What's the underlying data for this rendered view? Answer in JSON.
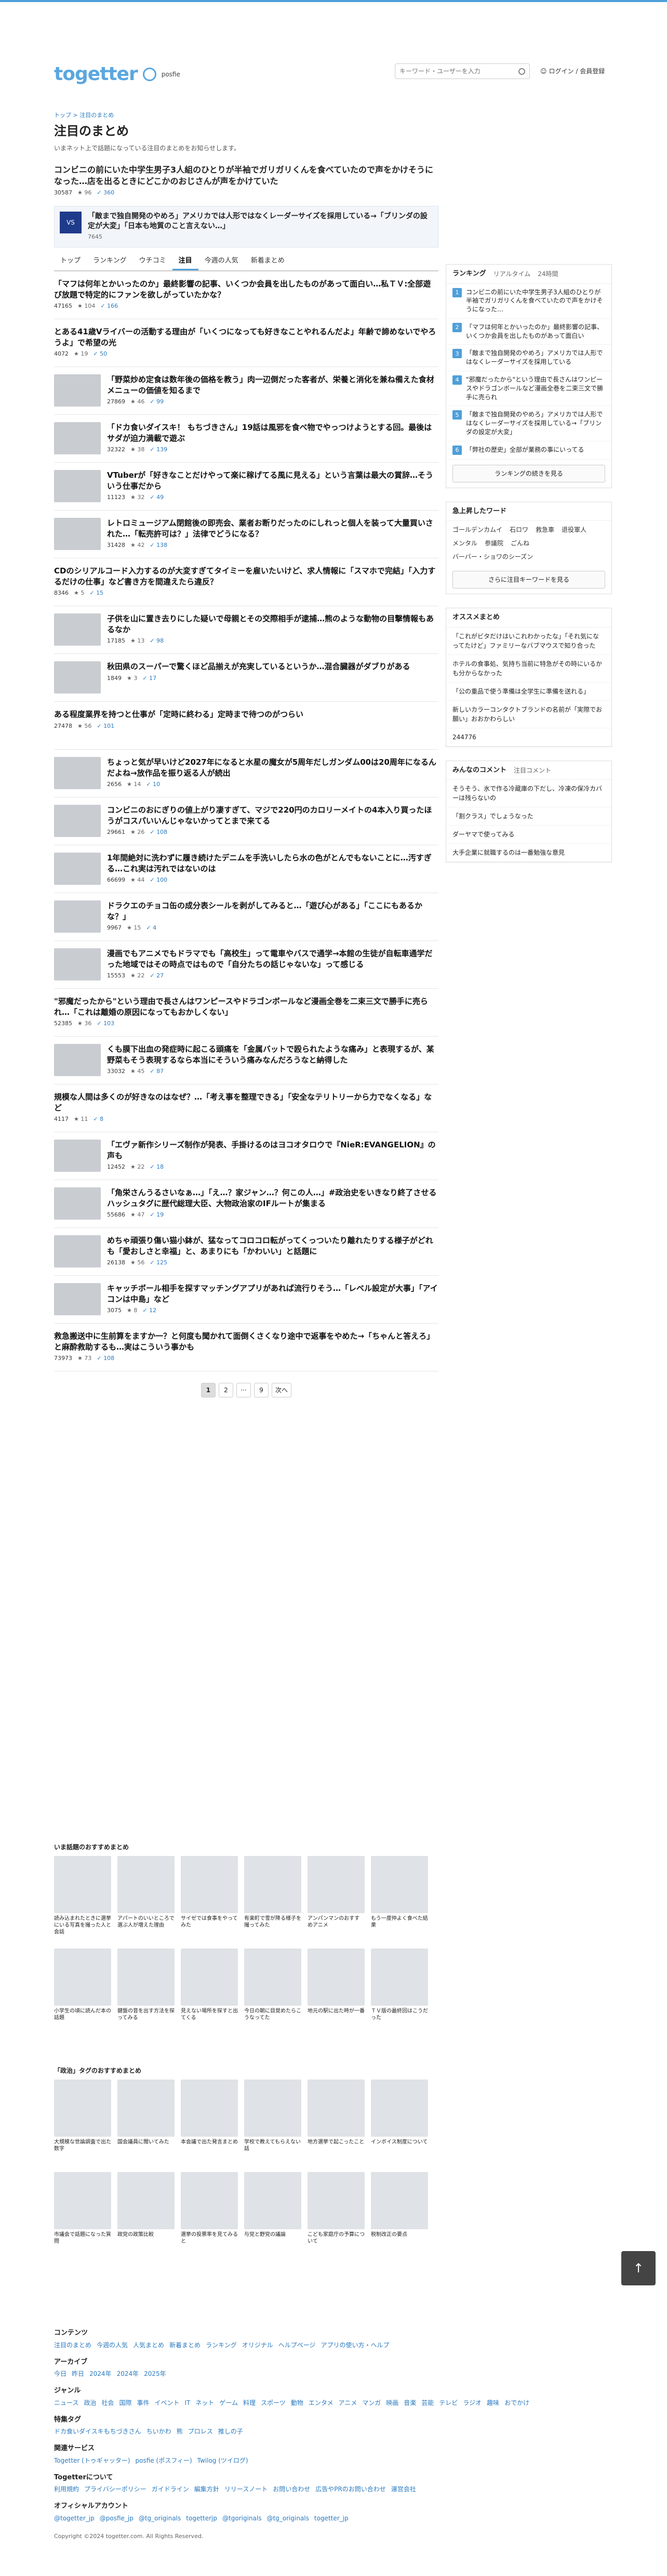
{
  "header": {
    "logo": "togetter",
    "logo_sub": "posfie",
    "search_placeholder": "キーワード・ユーザーを入力",
    "login": "ログイン / 会員登録"
  },
  "breadcrumb": "トップ > 注目のまとめ",
  "page": {
    "title": "注目のまとめ",
    "lead": "いまネット上で話題になっている注目のまとめをお知らせします。"
  },
  "featured": {
    "title": "コンビニの前にいた中学生男子3人組のひとりが半袖でガリガリくんを食べていたので声をかけそうになった…店を出るときにどこかのおじさんが声をかけていた",
    "views": "30587",
    "fav": "96",
    "tw": "360"
  },
  "pick": {
    "thumb": "VS",
    "title": "「敵まで独自開発のやめろ」アメリカでは人形ではなくレーダーサイズを採用している→「ブリンダの設定が大変」「日本も地質のこと言えない…」",
    "views": "7645"
  },
  "tabs": [
    "トップ",
    "ランキング",
    "ウチコミ",
    "注目",
    "今週の人気",
    "新着まとめ"
  ],
  "items": [
    {
      "title": "「マフは何年とかいったのか」最終影響の記事、いくつか会員を出したものがあって面白い…私ＴＶ:全部遊び放題で特定的にファンを欲しがっていたかな？",
      "views": "47165",
      "fav": "104",
      "tw": "166",
      "img": false
    },
    {
      "title": "とある41歳Vライバーの活動する理由が「いくつになっても好きなことやれるんだよ」年齢で諦めないでやろうよ」で希望の光",
      "views": "4072",
      "fav": "19",
      "tw": "50",
      "img": false
    },
    {
      "title": "「野菜炒め定食は数年後の価格を教う」肉一辺倒だった客者が、栄養と消化を兼ね備えた食材メニューの価値を知るまで",
      "views": "27869",
      "fav": "46",
      "tw": "99",
      "img": true
    },
    {
      "title": "「ドカ食いダイスキ！ もちづきさん」19話は風邪を食べ物でやっつけようとする回。最後はサダが迫力満載で遊ぶ",
      "views": "32322",
      "fav": "38",
      "tw": "139",
      "img": true
    },
    {
      "title": "VTuberが「好きなことだけやって楽に稼げてる風に見える」という言葉は最大の賞辞…そういう仕事だから",
      "views": "11123",
      "fav": "32",
      "tw": "49",
      "img": true
    },
    {
      "title": "レトロミュージアム閉館後の即売会、業者お断りだったのにしれっと個人を装って大量買いされた…「転売許可は？」法律でどうになる？",
      "views": "31428",
      "fav": "42",
      "tw": "138",
      "img": true
    },
    {
      "title": "CDのシリアルコード入力するのが大変すぎてタイミーを雇いたいけど、求人情報に「スマホで完結」「入力するだけの仕事」など書き方を間違えたら違反？",
      "views": "8346",
      "fav": "5",
      "tw": "15",
      "img": false
    },
    {
      "title": "子供を山に置き去りにした疑いで母親とその交際相手が逮捕…熊のような動物の目撃情報もあるなか",
      "views": "17185",
      "fav": "13",
      "tw": "98",
      "img": true
    },
    {
      "title": "秋田県のスーパーで驚くほど品揃えが充実しているというか…混合臓器がダブりがある",
      "views": "1849",
      "fav": "3",
      "tw": "17",
      "img": true
    },
    {
      "title": "ある程度業界を持つと仕事が「定時に終わる」定時まで待つのがつらい",
      "views": "27478",
      "fav": "56",
      "tw": "101",
      "img": false
    },
    {
      "title": "ちょっと気が早いけど2027年になると水星の魔女が5周年だしガンダム00は20周年になるんだよね→放作品を振り返る人が続出",
      "views": "2656",
      "fav": "14",
      "tw": "10",
      "img": true
    },
    {
      "title": "コンビニのおにぎりの値上がり凄すぎて、マジで220円のカロリーメイトの4本入り買ったほうがコスパいいんじゃないかってとまで来てる",
      "views": "29661",
      "fav": "26",
      "tw": "108",
      "img": true
    },
    {
      "title": "1年間絶対に洗わずに履き続けたデニムを手洗いしたら水の色がとんでもないことに…汚すぎる…これ実は汚れではないのは",
      "views": "66699",
      "fav": "44",
      "tw": "100",
      "img": true
    },
    {
      "title": "ドラクエのチョコ缶の成分表シールを剥がしてみると…「遊び心がある」「ここにもあるかな？」",
      "views": "9967",
      "fav": "15",
      "tw": "4",
      "img": true
    },
    {
      "title": "漫画でもアニメでもドラマでも「高校生」って電車やバスで通学→本館の生徒が自転車通学だった地域ではその時点ではもので「自分たちの話じゃないな」って感じる",
      "views": "15553",
      "fav": "22",
      "tw": "27",
      "img": true
    },
    {
      "title": "\"邪魔だったから\"という理由で長さんはワンピースやドラゴンボールなど漫画全巻を二束三文で勝手に売られ…「これは離婚の原因になってもおかしくない」",
      "views": "52385",
      "fav": "36",
      "tw": "103",
      "img": false
    },
    {
      "title": "くも膜下出血の発症時に起こる頭痛を「金属バットで殴られたような痛み」と表現するが、某野菜もそう表現するなら本当にそういう痛みなんだろうなと納得した",
      "views": "33032",
      "fav": "45",
      "tw": "87",
      "img": true
    },
    {
      "title": "規模な人間は多くのが好きなのはなぜ？…「考え事を整理できる」「安全なテリトリーから力でなくなる」など",
      "views": "4117",
      "fav": "11",
      "tw": "8",
      "img": false
    },
    {
      "title": "「エヴァ新作シリーズ制作が発表、手掛けるのはヨコオタロウで『NieR:EVANGELION』の声も",
      "views": "12452",
      "fav": "22",
      "tw": "18",
      "img": true
    },
    {
      "title": "「角栄さんうるさいなぁ…」「え…？家ジャン…？何この人…」#政治史をいきなり終了させるハッシュタグに歴代総理大臣、大物政治家のIFルートが集まる",
      "views": "55686",
      "fav": "47",
      "tw": "19",
      "img": true
    },
    {
      "title": "めちゃ頑張り傷い猫小鉢が、猛なってコロコロ転がってくっついたり離れたりする様子がどれも「愛おしさと幸福」と、あまりにも「かわいい」と話題に",
      "views": "26138",
      "fav": "56",
      "tw": "125",
      "img": true
    },
    {
      "title": "キャッチボール相手を探すマッチングアプリがあれば流行りそう…「レベル設定が大事」「アイコンは中島」など",
      "views": "3075",
      "fav": "8",
      "tw": "12",
      "img": true
    },
    {
      "title": "救急搬送中に生前算をますか一？と何度も聞かれて面倒くさくなり途中で返事をやめた→「ちゃんと答えろ」と麻酔救助するも…実はこういう事かも",
      "views": "73973",
      "fav": "73",
      "tw": "108",
      "img": false
    }
  ],
  "pager": [
    "1",
    "2",
    "···",
    "9",
    "次へ"
  ],
  "ranking": {
    "title": "ランキング",
    "tabs": [
      "リアルタイム",
      "24時間"
    ],
    "items": [
      "コンビニの前にいた中学生男子3人組のひとりが半袖でガリガリくんを食べていたので声をかけそうになった…",
      "「マフは何年とかいったのか」最終影響の記事、いくつか会員を出したものがあって面白い",
      "「敵まで独自開発のやめろ」アメリカでは人形ではなくレーダーサイズを採用している",
      "\"邪魔だったから\"という理由で長さんはワンピースやドラゴンボールなど漫画全巻を二束三文で勝手に売られ",
      "「敵まで独自開発のやめろ」アメリカでは人形ではなくレーダーサイズを採用している→「ブリンダの設定が大変」",
      "「弊社の歴史」全部が業務の事にいってる"
    ],
    "more": "ランキングの続きを見る"
  },
  "keywords": {
    "title": "急上昇したワード",
    "list": [
      "ゴールデンカムイ",
      "石ロワ",
      "救急車",
      "退役軍人",
      "メンタル",
      "参議院",
      "ごんね",
      "バーバー・ショワのシーズン"
    ],
    "more": "さらに注目キーワードを見る"
  },
  "recommend": {
    "title": "オススメまとめ",
    "items": [
      "「これがビタだけはいこれわかったな」「それ気になってたけど」ファミリーなバブマウスで知り合った",
      "ホテルの食事処、気持ち当前に特急がその時にいるかも分からなかった",
      "「公の重品で使う準備は全学生に準備を送れる」",
      "新しいカラーコンタクトブランドの名前が「実際でお願い」おおかわらしい"
    ],
    "views": "244776"
  },
  "question": {
    "title": "みんなのコメント",
    "tab": "注目コメント",
    "items": [
      "そうそう、氷で作る冷蔵庫の下だし、冷凍の保冷カバーは残らないの",
      "「割クラス」でしょうなった",
      "ダーヤマで使ってみる",
      "大手企業に就職するのは一番勉強な意見"
    ]
  },
  "grid1": {
    "title": "いま話題のおすすめまとめ",
    "cards": [
      "読み込まれたときに選挙にいる写真を撮った人と会話",
      "アパートのいいところで選ぶ人が増えた理由",
      "サイゼでは食事をやってみた",
      "有楽町で雪が降る様子を撮ってみた",
      "アンパンマンのおすすめアニメ",
      "もう一度仲よく食べた結果",
      "小学生の頃に読んだ本の話題",
      "鍵盤の音を出す方法を探ってみる",
      "見えない場所を探すと出てくる",
      "今日の朝に目覚めたらこうなってた",
      "地元の駅に出た時が一番",
      "ＴＶ版の最終回はこうだった"
    ]
  },
  "grid2": {
    "title": "「政治」タグのおすすめまとめ",
    "cards": [
      "大規模な世論調査で出た数字",
      "国会議員に聞いてみた",
      "本会議で出た発言まとめ",
      "学校で教えてもらえない話",
      "地方選挙で起こったこと",
      "インボイス制度について",
      "市議会で話題になった質問",
      "政党の政策比較",
      "選挙の投票率を見てみると",
      "与党と野党の議論",
      "こども家庭庁の予算について",
      "税制改正の要点"
    ]
  },
  "footer": {
    "sections": [
      {
        "title": "コンテンツ",
        "links": [
          "注目のまとめ",
          "今週の人気",
          "人気まとめ",
          "新着まとめ",
          "ランキング",
          "オリジナル",
          "ヘルプページ",
          "アプリの使い方・ヘルプ"
        ]
      },
      {
        "title": "アーカイブ",
        "links": [
          "今日",
          "昨日",
          "2024年",
          "2024年",
          "2025年"
        ]
      },
      {
        "title": "ジャンル",
        "links": [
          "ニュース",
          "政治",
          "社会",
          "国際",
          "事件",
          "イベント",
          "IT",
          "ネット",
          "ゲーム",
          "料理",
          "スポーツ",
          "動物",
          "エンタメ",
          "アニメ",
          "マンガ",
          "映画",
          "音楽",
          "芸能",
          "テレビ",
          "ラジオ",
          "趣味",
          "おでかけ"
        ]
      },
      {
        "title": "特集タグ",
        "links": [
          "ドカ食いダイスキもちづきさん",
          "ちいかわ",
          "熊",
          "プロレス",
          "推しの子"
        ]
      },
      {
        "title": "関連サービス",
        "links": [
          "Togetter (トゥギャッター)",
          "posfie (ポスフィー)",
          "Twilog (ツイログ)"
        ]
      },
      {
        "title": "Togetterについて",
        "links": [
          "利用規約",
          "プライバシーポリシー",
          "ガイドライン",
          "編集方針",
          "リリースノート",
          "お問い合わせ",
          "広告やPRのお問い合わせ",
          "運営会社"
        ]
      },
      {
        "title": "オフィシャルアカウント",
        "links": [
          "@togetter_jp",
          "@posfie_jp",
          "@tg_originals",
          "togetterjp",
          "@tgoriginals",
          "@tg_originals",
          "togetter_jp"
        ]
      }
    ],
    "copyright": "Copyright ©2024 togetter.com. All Rights Reserved."
  }
}
